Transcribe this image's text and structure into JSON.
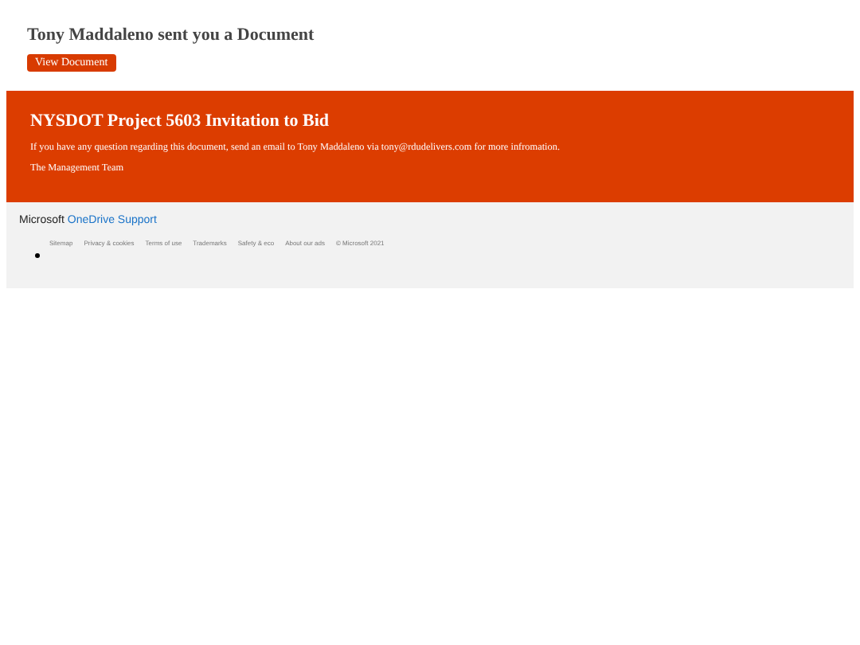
{
  "header": {
    "title": "Tony Maddaleno sent you a Document",
    "button": "View Document"
  },
  "banner": {
    "title": "NYSDOT Project 5603 Invitation to Bid",
    "message": "If you have any question regarding this document, send an email to Tony Maddaleno via tony@rdudelivers.com for more infromation.",
    "signature": "The Management Team"
  },
  "footer": {
    "brand": "Microsoft",
    "product": "OneDrive Support",
    "links": [
      "Sitemap",
      "Privacy & cookies",
      "Terms of use",
      "Trademarks",
      "Safety & eco",
      "About our ads",
      "© Microsoft 2021"
    ]
  }
}
